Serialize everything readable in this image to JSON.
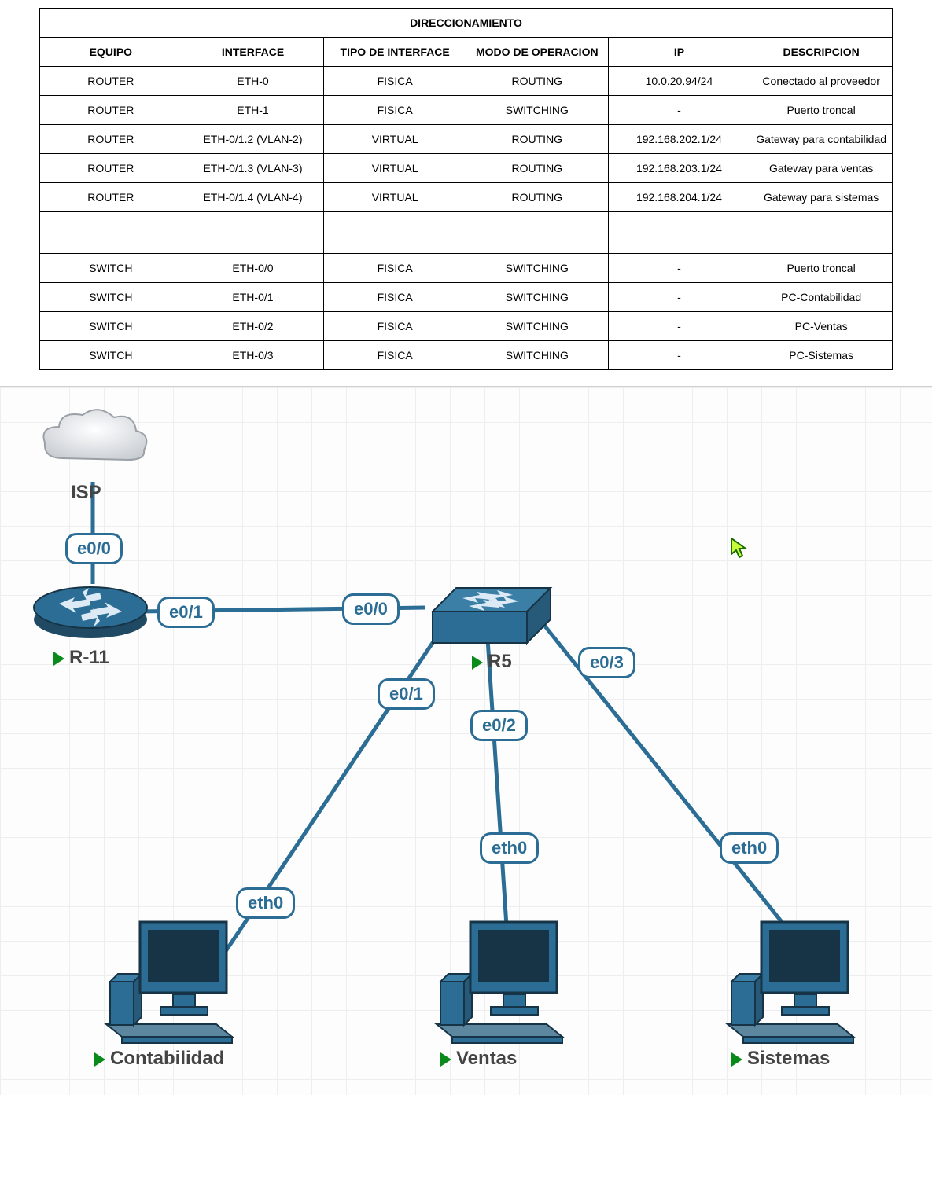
{
  "table": {
    "title": "DIRECCIONAMIENTO",
    "headers": [
      "EQUIPO",
      "INTERFACE",
      "TIPO DE INTERFACE",
      "MODO DE OPERACION",
      "IP",
      "DESCRIPCION"
    ],
    "rows": [
      [
        "ROUTER",
        "ETH-0",
        "FISICA",
        "ROUTING",
        "10.0.20.94/24",
        "Conectado al proveedor"
      ],
      [
        "ROUTER",
        "ETH-1",
        "FISICA",
        "SWITCHING",
        "-",
        "Puerto troncal"
      ],
      [
        "ROUTER",
        "ETH-0/1.2 (VLAN-2)",
        "VIRTUAL",
        "ROUTING",
        "192.168.202.1/24",
        "Gateway para contabilidad"
      ],
      [
        "ROUTER",
        "ETH-0/1.3 (VLAN-3)",
        "VIRTUAL",
        "ROUTING",
        "192.168.203.1/24",
        "Gateway para ventas"
      ],
      [
        "ROUTER",
        "ETH-0/1.4 (VLAN-4)",
        "VIRTUAL",
        "ROUTING",
        "192.168.204.1/24",
        "Gateway para sistemas"
      ],
      [
        "",
        "",
        "",
        "",
        "",
        ""
      ],
      [
        "SWITCH",
        "ETH-0/0",
        "FISICA",
        "SWITCHING",
        "-",
        "Puerto troncal"
      ],
      [
        "SWITCH",
        "ETH-0/1",
        "FISICA",
        "SWITCHING",
        "-",
        "PC-Contabilidad"
      ],
      [
        "SWITCH",
        "ETH-0/2",
        "FISICA",
        "SWITCHING",
        "-",
        "PC-Ventas"
      ],
      [
        "SWITCH",
        "ETH-0/3",
        "FISICA",
        "SWITCHING",
        "-",
        "PC-Sistemas"
      ]
    ]
  },
  "diagram": {
    "nodes": {
      "isp": {
        "label": "ISP"
      },
      "router": {
        "label": "R-11"
      },
      "switch": {
        "label": "R5"
      },
      "pc1": {
        "label": "Contabilidad"
      },
      "pc2": {
        "label": "Ventas"
      },
      "pc3": {
        "label": "Sistemas"
      }
    },
    "ifaces": {
      "r_e00": "e0/0",
      "r_e01": "e0/1",
      "s_e00": "e0/0",
      "s_e01": "e0/1",
      "s_e02": "e0/2",
      "s_e03": "e0/3",
      "pc1_eth0": "eth0",
      "pc2_eth0": "eth0",
      "pc3_eth0": "eth0"
    }
  }
}
